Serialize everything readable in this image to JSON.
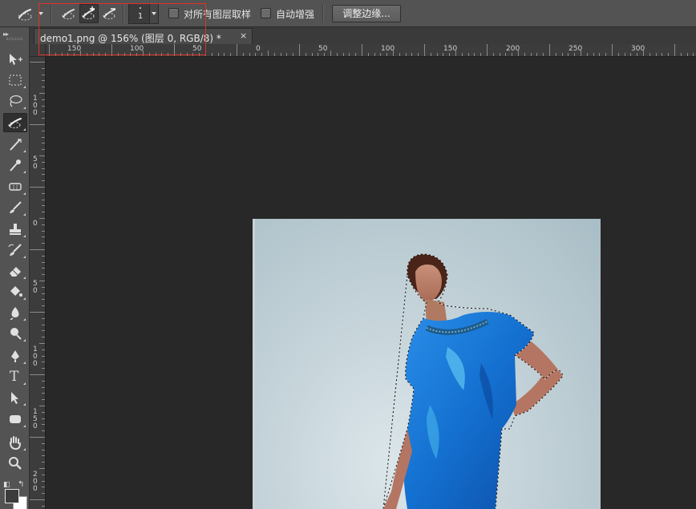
{
  "options_bar": {
    "tool_preset_icon": "quick-selection-brush-icon",
    "modes": [
      {
        "name": "new-selection-mode",
        "icon": "brush-new-icon",
        "active": false
      },
      {
        "name": "add-to-selection-mode",
        "icon": "brush-add-icon",
        "active": true
      },
      {
        "name": "subtract-from-selection-mode",
        "icon": "brush-subtract-icon",
        "active": false
      }
    ],
    "brush_size": "1",
    "sample_all_layers_label": "对所有图层取样",
    "sample_all_layers_checked": false,
    "auto_enhance_label": "自动增强",
    "auto_enhance_checked": false,
    "refine_edge_label": "调整边缘..."
  },
  "document_tab": {
    "title": "demo1.png @ 156% (图层 0, RGB/8) *",
    "close_label": "×"
  },
  "rulers": {
    "horizontal_labels": [
      "150",
      "100",
      "50",
      "0",
      "50",
      "100",
      "150",
      "200",
      "250",
      "300"
    ],
    "vertical_labels": [
      "100",
      "50",
      "0",
      "50",
      "100",
      "150",
      "200"
    ]
  },
  "toolbar": {
    "collapse_label": "▸▸",
    "tools": [
      {
        "name": "move-tool",
        "icon": "move-icon"
      },
      {
        "name": "marquee-tool",
        "icon": "rectangular-marquee-icon"
      },
      {
        "name": "lasso-tool",
        "icon": "lasso-icon"
      },
      {
        "name": "quick-selection-tool",
        "icon": "quick-selection-icon",
        "active": true
      },
      {
        "name": "crop-tool",
        "icon": "crop-icon"
      },
      {
        "name": "eyedropper-tool",
        "icon": "eyedropper-icon"
      },
      {
        "name": "healing-brush-tool",
        "icon": "bandage-icon"
      },
      {
        "name": "brush-tool",
        "icon": "brush-icon"
      },
      {
        "name": "clone-stamp-tool",
        "icon": "stamp-icon"
      },
      {
        "name": "history-brush-tool",
        "icon": "history-brush-icon"
      },
      {
        "name": "eraser-tool",
        "icon": "eraser-icon"
      },
      {
        "name": "paint-bucket-tool",
        "icon": "paint-bucket-icon"
      },
      {
        "name": "blur-tool",
        "icon": "blur-drop-icon"
      },
      {
        "name": "dodge-tool",
        "icon": "dodge-icon"
      },
      {
        "name": "pen-tool",
        "icon": "pen-icon"
      },
      {
        "name": "type-tool",
        "icon": "type-icon",
        "glyph": "T"
      },
      {
        "name": "path-selection-tool",
        "icon": "arrow-selection-icon"
      },
      {
        "name": "shape-tool",
        "icon": "rounded-rectangle-icon"
      },
      {
        "name": "hand-tool",
        "icon": "hand-icon"
      },
      {
        "name": "zoom-tool",
        "icon": "zoom-icon"
      }
    ],
    "foreground_color": "#3c3c3c",
    "background_color": "#ffffff"
  },
  "colors": {
    "highlight_box": "#e0322a",
    "dress_blue": "#1f7bd6",
    "backdrop": "#c4d3d9"
  }
}
